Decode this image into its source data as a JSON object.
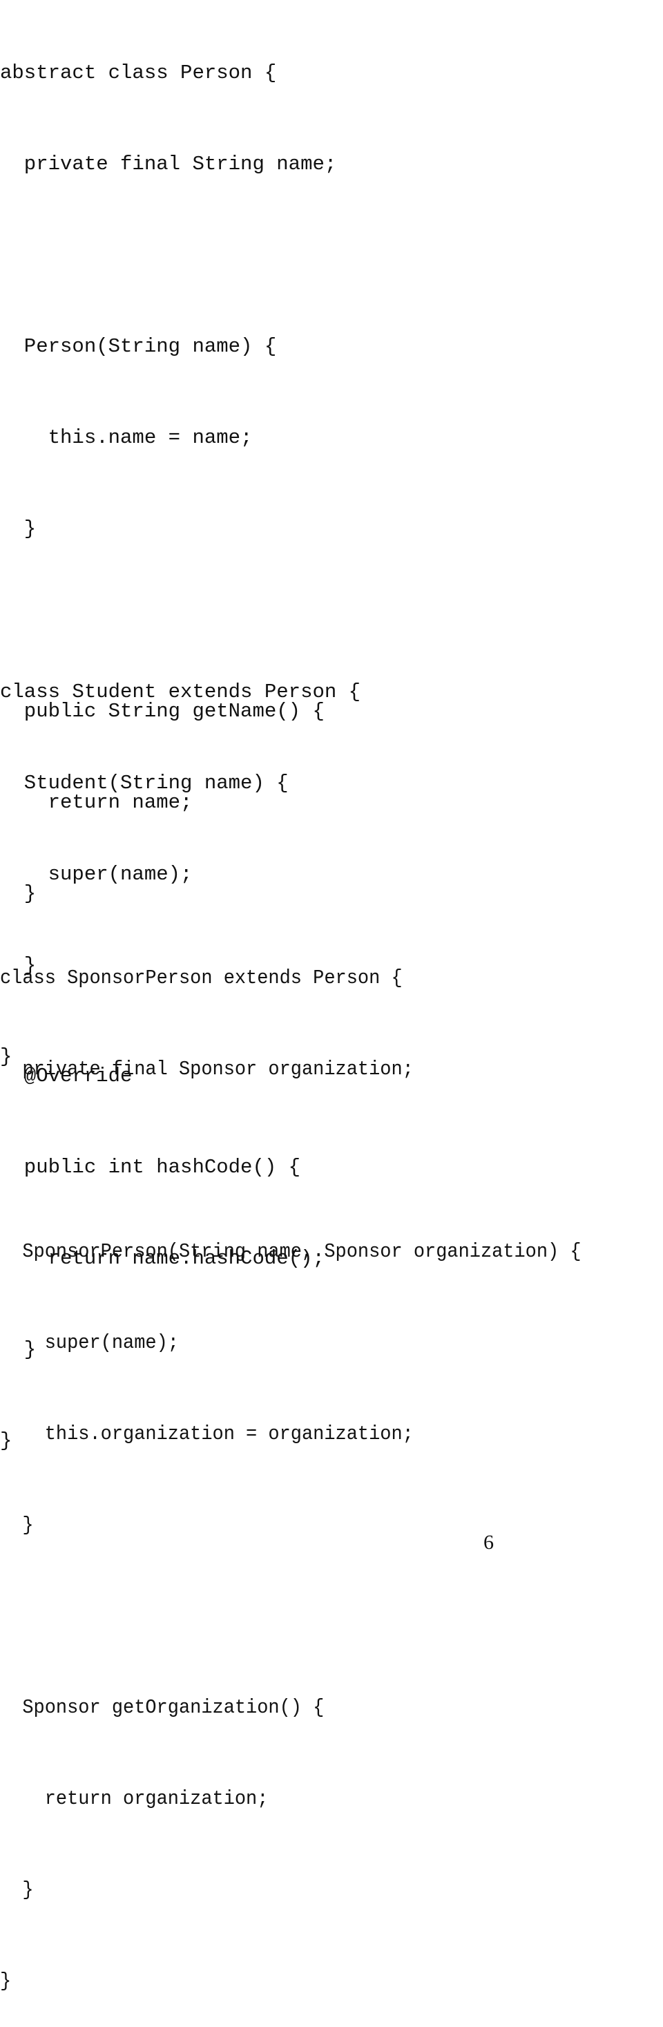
{
  "blocks": [
    {
      "name": "Person",
      "lines": [
        "abstract class Person {",
        "  private final String name;",
        "",
        "  Person(String name) {",
        "    this.name = name;",
        "  }",
        "",
        "  public String getName() {",
        "    return name;",
        "  }",
        "",
        "  @Override",
        "  public int hashCode() {",
        "    return name.hashCode();",
        "  }",
        "}"
      ]
    },
    {
      "name": "Student",
      "lines": [
        "class Student extends Person {",
        "  Student(String name) {",
        "    super(name);",
        "  }",
        "}"
      ]
    },
    {
      "name": "SponsorPerson",
      "lines": [
        "class SponsorPerson extends Person {",
        "  private final Sponsor organization;",
        "",
        "  SponsorPerson(String name, Sponsor organization) {",
        "    super(name);",
        "    this.organization = organization;",
        "  }",
        "",
        "  Sponsor getOrganization() {",
        "    return organization;",
        "  }",
        "}"
      ]
    }
  ],
  "page_number": "6"
}
